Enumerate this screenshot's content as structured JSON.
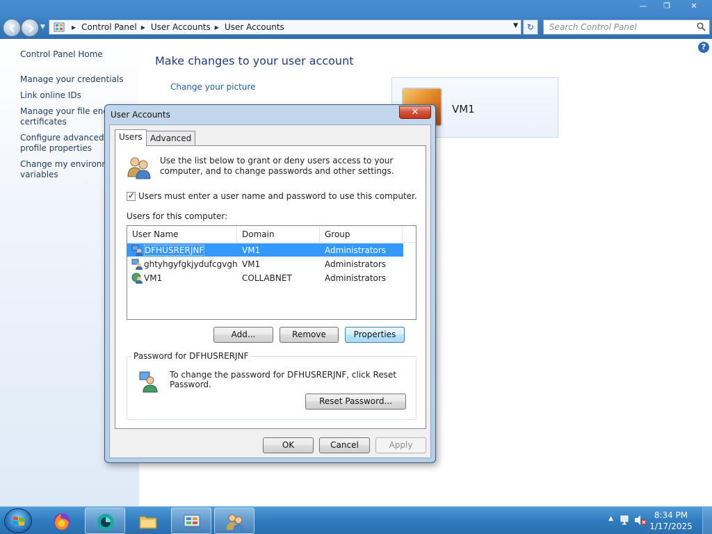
{
  "window": {
    "breadcrumb": [
      "Control Panel",
      "User Accounts",
      "User Accounts"
    ],
    "search_placeholder": "Search Control Panel"
  },
  "left_pane": {
    "items": [
      "Control Panel Home",
      "Manage your credentials",
      "Link online IDs",
      "Manage your file encry\ncertificates",
      "Configure advanced us\nprofile properties",
      "Change my environme\nvariables"
    ]
  },
  "main": {
    "title": "Make changes to your user account",
    "link_change_picture": "Change your picture",
    "user_tile_name": "VM1"
  },
  "dialog": {
    "title": "User Accounts",
    "tabs": [
      "Users",
      "Advanced"
    ],
    "info_text": "Use the list below to grant or deny users access to your computer, and to change passwords and other settings.",
    "checkbox_label": "Users must enter a user name and password to use this computer.",
    "checkbox_checked": true,
    "users_label": "Users for this computer:",
    "columns": [
      "User Name",
      "Domain",
      "Group"
    ],
    "rows": [
      {
        "name": "DFHUSRERJNF",
        "domain": "VM1",
        "group": "Administrators",
        "selected": true
      },
      {
        "name": "ghtyhgyfgkjydufcgvgh",
        "domain": "VM1",
        "group": "Administrators",
        "selected": false
      },
      {
        "name": "VM1",
        "domain": "COLLABNET",
        "group": "Administrators",
        "selected": false
      }
    ],
    "buttons": {
      "add": "Add...",
      "remove": "Remove",
      "properties": "Properties"
    },
    "password_group_label": "Password for DFHUSRERJNF",
    "password_text": "To change the password for DFHUSRERJNF, click Reset Password.",
    "reset_password": "Reset Password...",
    "ok": "OK",
    "cancel": "Cancel",
    "apply": "Apply"
  },
  "taskbar": {
    "time": "8:34 PM",
    "date": "1/17/2025",
    "items": [
      "start-orb",
      "firefox-icon",
      "app-icon",
      "explorer-icon",
      "control-panel-icon",
      "user-accounts-icon"
    ]
  }
}
